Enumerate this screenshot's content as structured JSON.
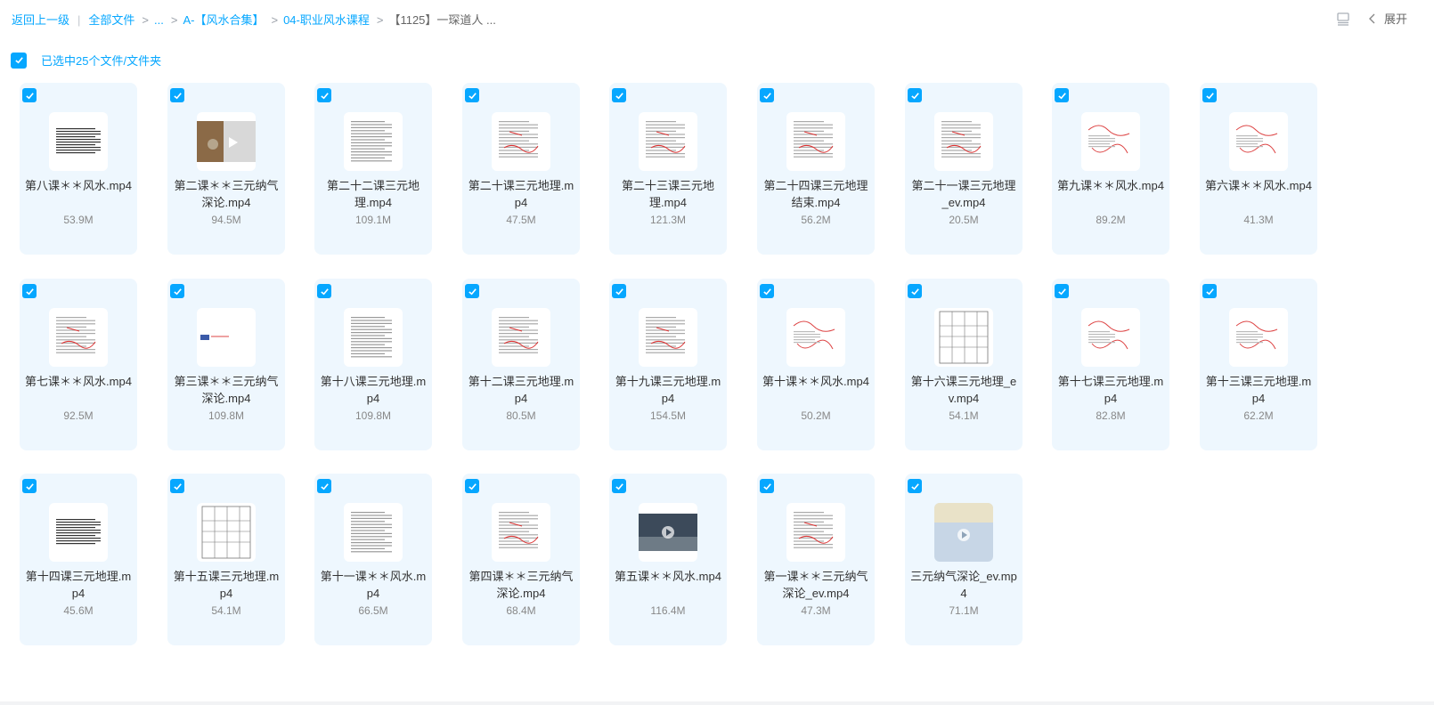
{
  "breadcrumb": {
    "back": "返回上一级",
    "all_files": "全部文件",
    "ellipsis": "...",
    "level1": "A-【风水合集】",
    "level2": "04-职业风水课程",
    "current": "【1125】一琛道人 ..."
  },
  "toolbar": {
    "expand_label": "展开"
  },
  "selection": {
    "text": "已选中25个文件/文件夹",
    "checked": true
  },
  "colors": {
    "accent": "#06a7ff",
    "card_bg": "#eef7fe"
  },
  "files": [
    {
      "name": "第八课＊＊风水.mp4",
      "size": "53.9M",
      "thumb": "doc-dense"
    },
    {
      "name": "第二课＊＊三元纳气深论.mp4",
      "size": "94.5M",
      "thumb": "photo"
    },
    {
      "name": "第二十二课三元地理.mp4",
      "size": "109.1M",
      "thumb": "doc"
    },
    {
      "name": "第二十课三元地理.mp4",
      "size": "47.5M",
      "thumb": "doc-red"
    },
    {
      "name": "第二十三课三元地理.mp4",
      "size": "121.3M",
      "thumb": "doc-red"
    },
    {
      "name": "第二十四课三元地理结束.mp4",
      "size": "56.2M",
      "thumb": "doc-red"
    },
    {
      "name": "第二十一课三元地理_ev.mp4",
      "size": "20.5M",
      "thumb": "doc-red"
    },
    {
      "name": "第九课＊＊风水.mp4",
      "size": "89.2M",
      "thumb": "sketch"
    },
    {
      "name": "第六课＊＊风水.mp4",
      "size": "41.3M",
      "thumb": "sketch"
    },
    {
      "name": "第七课＊＊风水.mp4",
      "size": "92.5M",
      "thumb": "doc-red"
    },
    {
      "name": "第三课＊＊三元纳气深论.mp4",
      "size": "109.8M",
      "thumb": "blank"
    },
    {
      "name": "第十八课三元地理.mp4",
      "size": "109.8M",
      "thumb": "doc"
    },
    {
      "name": "第十二课三元地理.mp4",
      "size": "80.5M",
      "thumb": "doc-red"
    },
    {
      "name": "第十九课三元地理.mp4",
      "size": "154.5M",
      "thumb": "doc-red"
    },
    {
      "name": "第十课＊＊风水.mp4",
      "size": "50.2M",
      "thumb": "sketch"
    },
    {
      "name": "第十六课三元地理_ev.mp4",
      "size": "54.1M",
      "thumb": "table"
    },
    {
      "name": "第十七课三元地理.mp4",
      "size": "82.8M",
      "thumb": "sketch"
    },
    {
      "name": "第十三课三元地理.mp4",
      "size": "62.2M",
      "thumb": "sketch"
    },
    {
      "name": "第十四课三元地理.mp4",
      "size": "45.6M",
      "thumb": "doc-dense"
    },
    {
      "name": "第十五课三元地理.mp4",
      "size": "54.1M",
      "thumb": "table"
    },
    {
      "name": "第十一课＊＊风水.mp4",
      "size": "66.5M",
      "thumb": "doc"
    },
    {
      "name": "第四课＊＊三元纳气深论.mp4",
      "size": "68.4M",
      "thumb": "doc-red"
    },
    {
      "name": "第五课＊＊风水.mp4",
      "size": "116.4M",
      "thumb": "video"
    },
    {
      "name": "第一课＊＊三元纳气深论_ev.mp4",
      "size": "47.3M",
      "thumb": "doc-red"
    },
    {
      "name": "三元纳气深论_ev.mp4",
      "size": "71.1M",
      "thumb": "video-sky"
    }
  ]
}
